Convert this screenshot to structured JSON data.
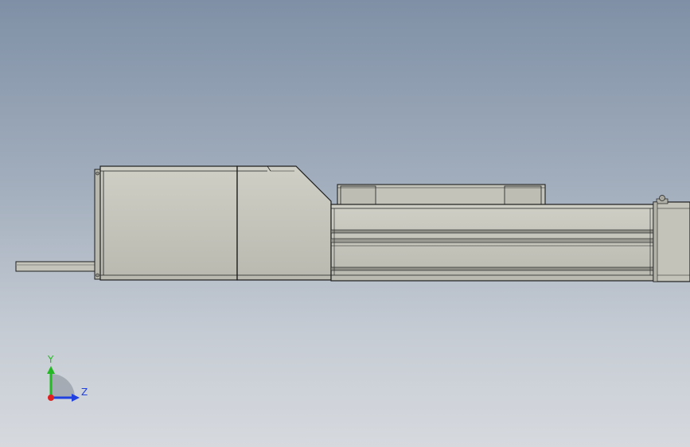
{
  "colors": {
    "background_top": "#7f90a6",
    "background_bottom": "#d6d9de",
    "part_fill": "#c3c3b9",
    "part_edge": "#1e1e1e",
    "axis_x": "#e02020",
    "axis_y": "#25b825",
    "axis_z": "#2040e0"
  },
  "triad": {
    "y_label": "Y",
    "z_label": "Z"
  }
}
